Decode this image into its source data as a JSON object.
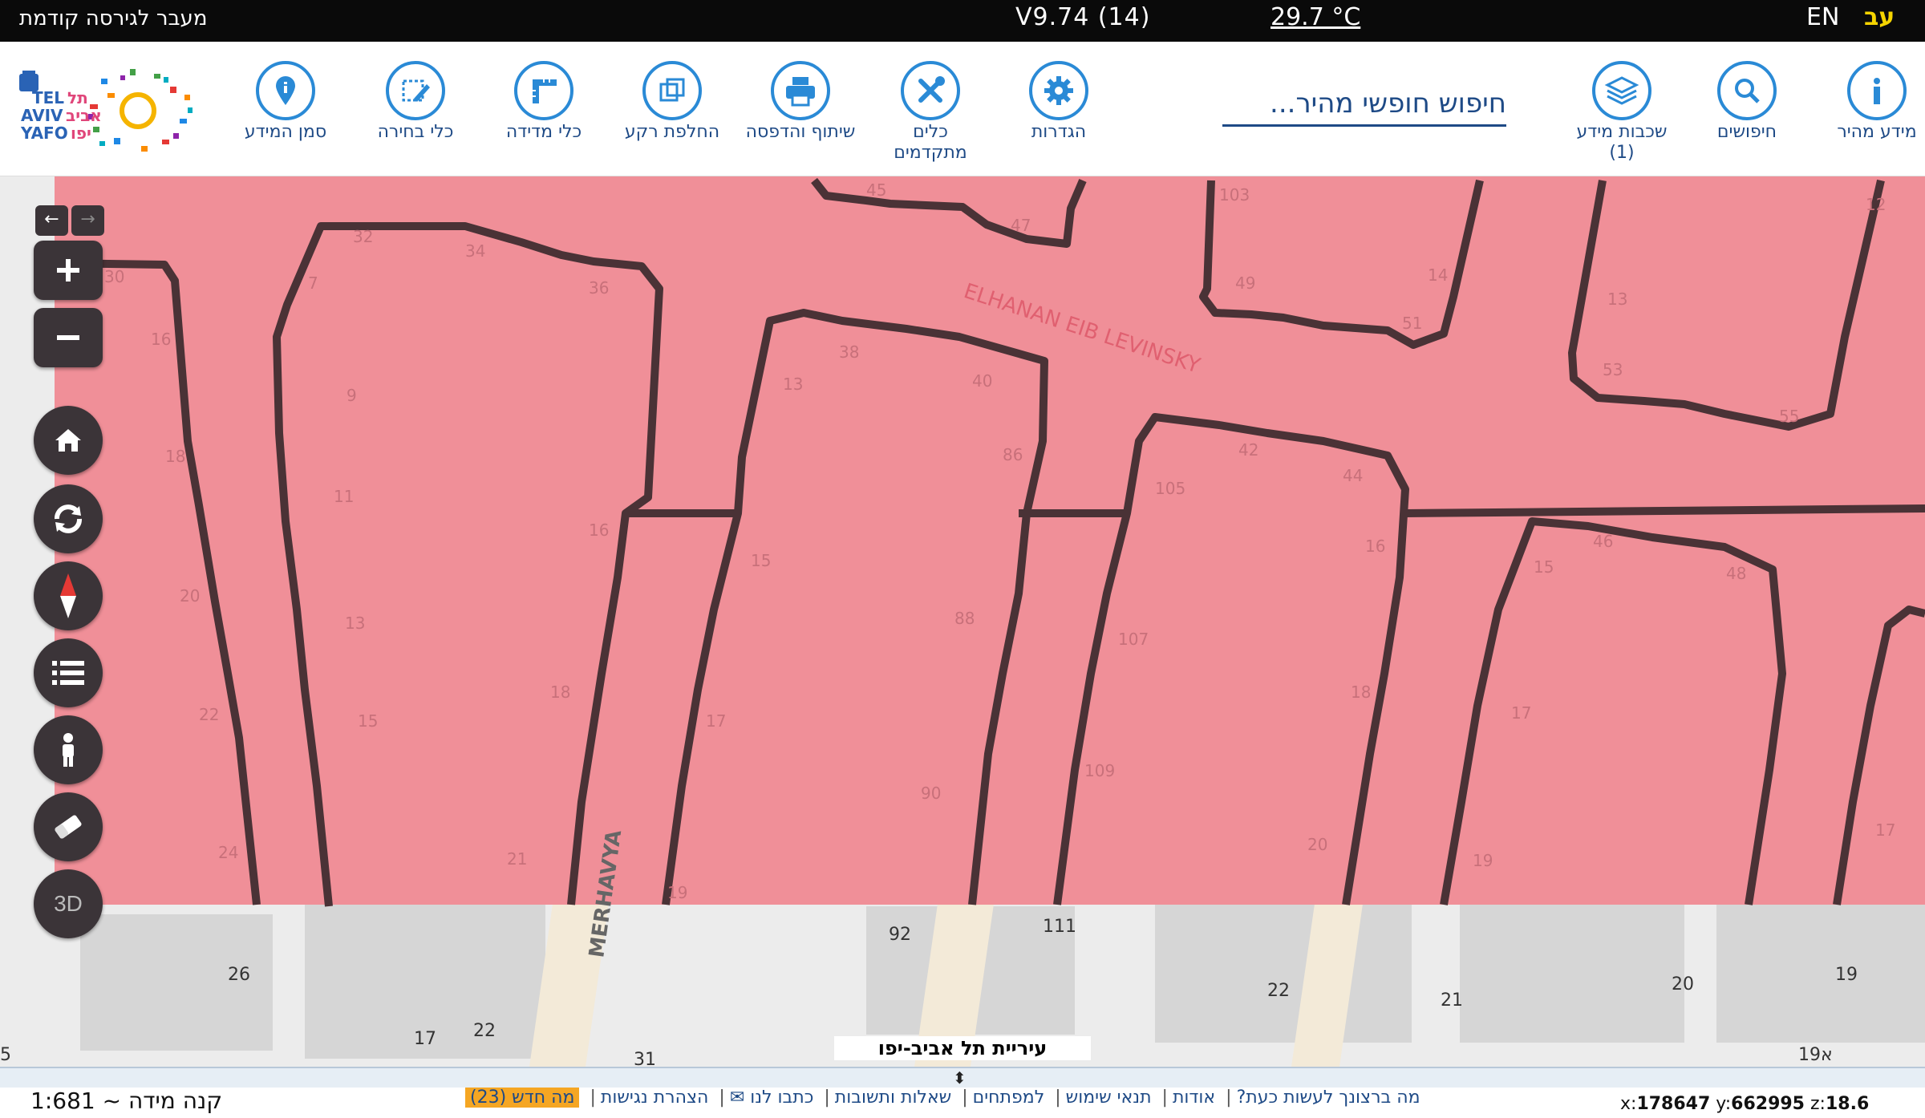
{
  "topbar": {
    "prev_version": "מעבר לגירסה קודמת",
    "version": "V9.74 (14)",
    "temperature": "29.7 °C",
    "lang_en": "EN",
    "lang_he": "עב"
  },
  "toolbar": {
    "logo_text": [
      "TEL",
      "תל",
      "AVIV",
      "אביב",
      "YAFO",
      "יפו"
    ],
    "tools": [
      {
        "label": "מידע מהיר",
        "icon": "info-icon"
      },
      {
        "label": "חיפושים",
        "icon": "search-icon"
      },
      {
        "label": "שכבות מידע (1)",
        "icon": "layers-icon"
      },
      {
        "label": "הגדרות",
        "icon": "gear-icon"
      },
      {
        "label": "כלים מתקדמים",
        "icon": "tools-icon"
      },
      {
        "label": "שיתוף והדפסה",
        "icon": "printer-icon"
      },
      {
        "label": "החלפת רקע",
        "icon": "basemap-icon"
      },
      {
        "label": "כלי מדידה",
        "icon": "ruler-icon"
      },
      {
        "label": "כלי בחירה",
        "icon": "select-icon"
      },
      {
        "label": "סמן המידע",
        "icon": "pin-icon"
      }
    ],
    "search_placeholder": "חיפוש חופשי מהיר..."
  },
  "map": {
    "street_labels": [
      "ELHANAN EIB LEVINSKY",
      "MERHAVYA"
    ],
    "parcel_numbers": [
      "45",
      "47",
      "103",
      "32",
      "34",
      "36",
      "7",
      "30",
      "16",
      "49",
      "14",
      "51",
      "12",
      "13",
      "53",
      "55",
      "38",
      "40",
      "9",
      "13",
      "18",
      "86",
      "105",
      "42",
      "44",
      "11",
      "16",
      "15",
      "46",
      "48",
      "20",
      "13",
      "88",
      "107",
      "16",
      "15",
      "22",
      "15",
      "18",
      "17",
      "17",
      "90",
      "109",
      "18",
      "24",
      "21",
      "19",
      "20",
      "19",
      "17"
    ],
    "base_numbers": [
      "92",
      "111",
      "26",
      "22",
      "21",
      "20",
      "19",
      "17",
      "22",
      "5",
      "31",
      "א19"
    ],
    "city_label": "עיריית תל אביב-יפו",
    "highlight_color": "#f08f98",
    "controls": [
      "back-arrow-icon",
      "forward-arrow-icon",
      "zoom-in-icon",
      "zoom-out-icon",
      "home-icon",
      "refresh-icon",
      "compass-icon",
      "list-icon",
      "street-view-icon",
      "eraser-icon"
    ],
    "btn_3d": "3D"
  },
  "bottombar": {
    "scale": "קנה מידה ~ 1:681",
    "links": [
      "מה ברצונך לעשות כעת?",
      "אודות",
      "תנאי שימוש",
      "למפתחים",
      "שאלות ותשובות",
      "כתבו לנו ✉",
      "הצהרת נגישות"
    ],
    "whats_new": "מה חדש (23)",
    "coord_x_label": "x:",
    "coord_x": "178647",
    "coord_y_label": "y:",
    "coord_y": "662995",
    "coord_z_label": "z:",
    "coord_z": "18.6"
  }
}
